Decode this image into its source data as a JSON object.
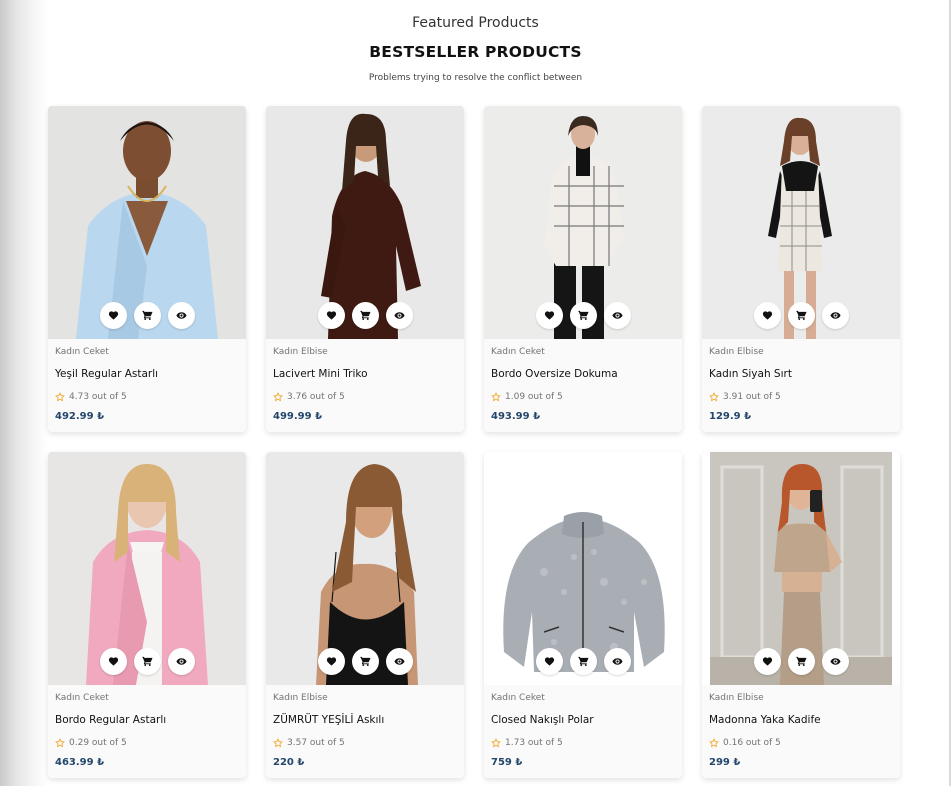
{
  "header": {
    "eyebrow": "Featured Products",
    "title": "BESTSELLER PRODUCTS",
    "subtitle": "Problems trying to resolve the conflict between"
  },
  "colors": {
    "price": "#23466b",
    "star": "#f3a528",
    "card_bg": "#fafafa"
  },
  "icons": {
    "favorite": "heart-icon",
    "cart": "cart-icon",
    "view": "eye-icon",
    "rating": "star-icon"
  },
  "products": [
    {
      "category": "Kadın Ceket",
      "name": "Yeşil Regular Astarlı",
      "rating": "4.73 out of 5",
      "price": "492.99 ₺",
      "image": "woman in light blue blazer"
    },
    {
      "category": "Kadın Elbise",
      "name": "Lacivert Mini Triko",
      "rating": "3.76 out of 5",
      "price": "499.99 ₺",
      "image": "woman in dark brown knit dress"
    },
    {
      "category": "Kadın Ceket",
      "name": "Bordo Oversize Dokuma",
      "rating": "1.09 out of 5",
      "price": "493.99 ₺",
      "image": "woman in white tweed jacket"
    },
    {
      "category": "Kadın Elbise",
      "name": "Kadın Siyah Sırt",
      "rating": "3.91 out of 5",
      "price": "129.9 ₺",
      "image": "woman in black and white tweed dress"
    },
    {
      "category": "Kadın Ceket",
      "name": "Bordo Regular Astarlı",
      "rating": "0.29 out of 5",
      "price": "463.99 ₺",
      "image": "woman in pink blazer"
    },
    {
      "category": "Kadın Elbise",
      "name": "ZÜMRÜT YEŞİLİ Askılı",
      "rating": "3.57 out of 5",
      "price": "220 ₺",
      "image": "woman in black velvet slip dress"
    },
    {
      "category": "Kadın Ceket",
      "name": "Closed Nakışlı Polar",
      "rating": "1.73 out of 5",
      "price": "759 ₺",
      "image": "grey fleece jacket"
    },
    {
      "category": "Kadın Elbise",
      "name": "Madonna Yaka Kadife",
      "rating": "0.16 out of 5",
      "price": "299 ₺",
      "image": "woman in beige knit set taking mirror selfie"
    }
  ]
}
